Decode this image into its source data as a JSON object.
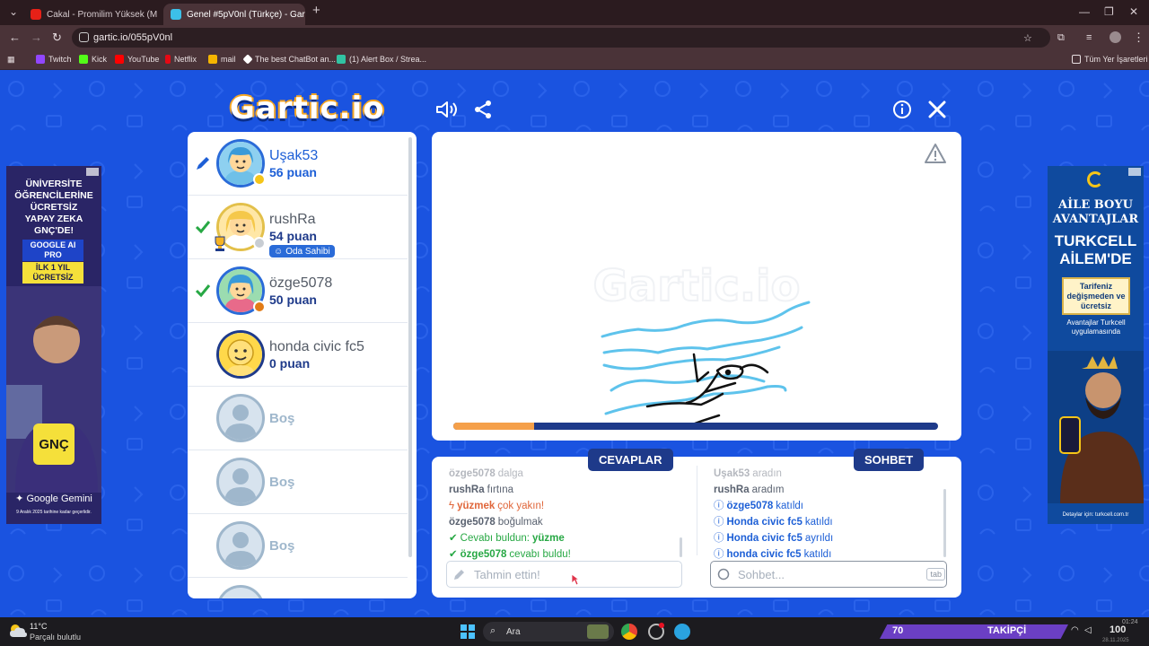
{
  "browser": {
    "tabs": [
      {
        "title": "Cakal - Promilim Yüksek (M",
        "active": false,
        "favicon_color": "#e62117"
      },
      {
        "title": "Genel #5pV0nl (Türkçe) - Gartic",
        "active": true,
        "favicon_color": "#3cc0e8"
      }
    ],
    "url": "gartic.io/055pV0nl",
    "bookmarks": [
      {
        "label": "Twitch",
        "color": "#9146ff"
      },
      {
        "label": "Kick",
        "color": "#53fc18"
      },
      {
        "label": "YouTube",
        "color": "#ff0000"
      },
      {
        "label": "Netflix",
        "color": "#e50914"
      },
      {
        "label": "mail",
        "color": "#f4b400"
      },
      {
        "label": "The best ChatBot an...",
        "color": "#ffffff"
      },
      {
        "label": "(1) Alert Box / Strea...",
        "color": "#31c3a2"
      }
    ],
    "all_bookmarks": "Tüm Yer İşaretleri"
  },
  "game": {
    "logo": "Gartic.io",
    "players": [
      {
        "name": "Uşak53",
        "score": "56 puan",
        "state": "drawing",
        "dot_color": "#f5c518"
      },
      {
        "name": "rushRa",
        "score": "54 puan",
        "state": "guessed",
        "dot_color": "#c8cdd3",
        "badge": "Oda Sahibi"
      },
      {
        "name": "özge5078",
        "score": "50 puan",
        "state": "guessed",
        "dot_color": "#e27b16"
      },
      {
        "name": "honda civic fc5",
        "score": "0 puan",
        "state": "none",
        "dot_color": ""
      }
    ],
    "empty_slot_label": "Boş",
    "progress_fraction": 0.17,
    "answers_tab": "CEVAPLAR",
    "chat_tab": "SOHBET",
    "answers": [
      {
        "user": "özge5078",
        "text": "dalga",
        "kind": "faded"
      },
      {
        "user": "rushRa",
        "text": "fırtına",
        "kind": "plain"
      },
      {
        "user": "yüzmek",
        "text": "çok yakın!",
        "kind": "close"
      },
      {
        "user": "özge5078",
        "text": "boğulmak",
        "kind": "plain"
      },
      {
        "user": "Cevabı buldun:",
        "text": "yüzme",
        "kind": "found"
      },
      {
        "user": "özge5078",
        "text": "cevabı buldu!",
        "kind": "found-other"
      }
    ],
    "chat": [
      {
        "user": "Uşak53",
        "text": "aradın",
        "kind": "faded"
      },
      {
        "user": "rushRa",
        "text": "aradım",
        "kind": "plain"
      },
      {
        "user": "özge5078",
        "text": "katıldı",
        "kind": "info"
      },
      {
        "user": "Honda civic fc5",
        "text": "katıldı",
        "kind": "info"
      },
      {
        "user": "Honda civic fc5",
        "text": "ayrıldı",
        "kind": "info"
      },
      {
        "user": "honda civic fc5",
        "text": "katıldı",
        "kind": "info"
      }
    ],
    "guess_placeholder": "Tahmin ettin!",
    "chat_placeholder": "Sohbet...",
    "tab_key": "tab"
  },
  "ads": {
    "left": {
      "lines": [
        "ÜNİVERSİTE",
        "ÖĞRENCİLERİNE",
        "ÜCRETSİZ",
        "YAPAY ZEKA",
        "GNÇ'DE!"
      ],
      "box1": "GOOGLE AI PRO",
      "box2": "İLK 1 YIL ÜCRETSİZ",
      "brand": "GNÇ",
      "footer": "Google Gemini",
      "fineprint": "9 Aralık 2025 tarihine kadar geçerlidir."
    },
    "right": {
      "lines": [
        "AİLE BOYU",
        "AVANTAJLAR"
      ],
      "brand1": "TURKCELL",
      "brand2": "AİLEM'DE",
      "box1": "Tarifeniz değişmeden ve ücretsiz",
      "box2": "Avantajlar Turkcell uygulamasında",
      "footer": "Detaylar için: turkcell.com.tr"
    }
  },
  "taskbar": {
    "weather_temp": "11°C",
    "weather_desc": "Parçalı bulutlu",
    "search": "Ara",
    "follow_count": "70",
    "follow_label": "TAKİPÇİ",
    "follow_total": "100",
    "time": "01:24",
    "date": "28.11.2025"
  }
}
